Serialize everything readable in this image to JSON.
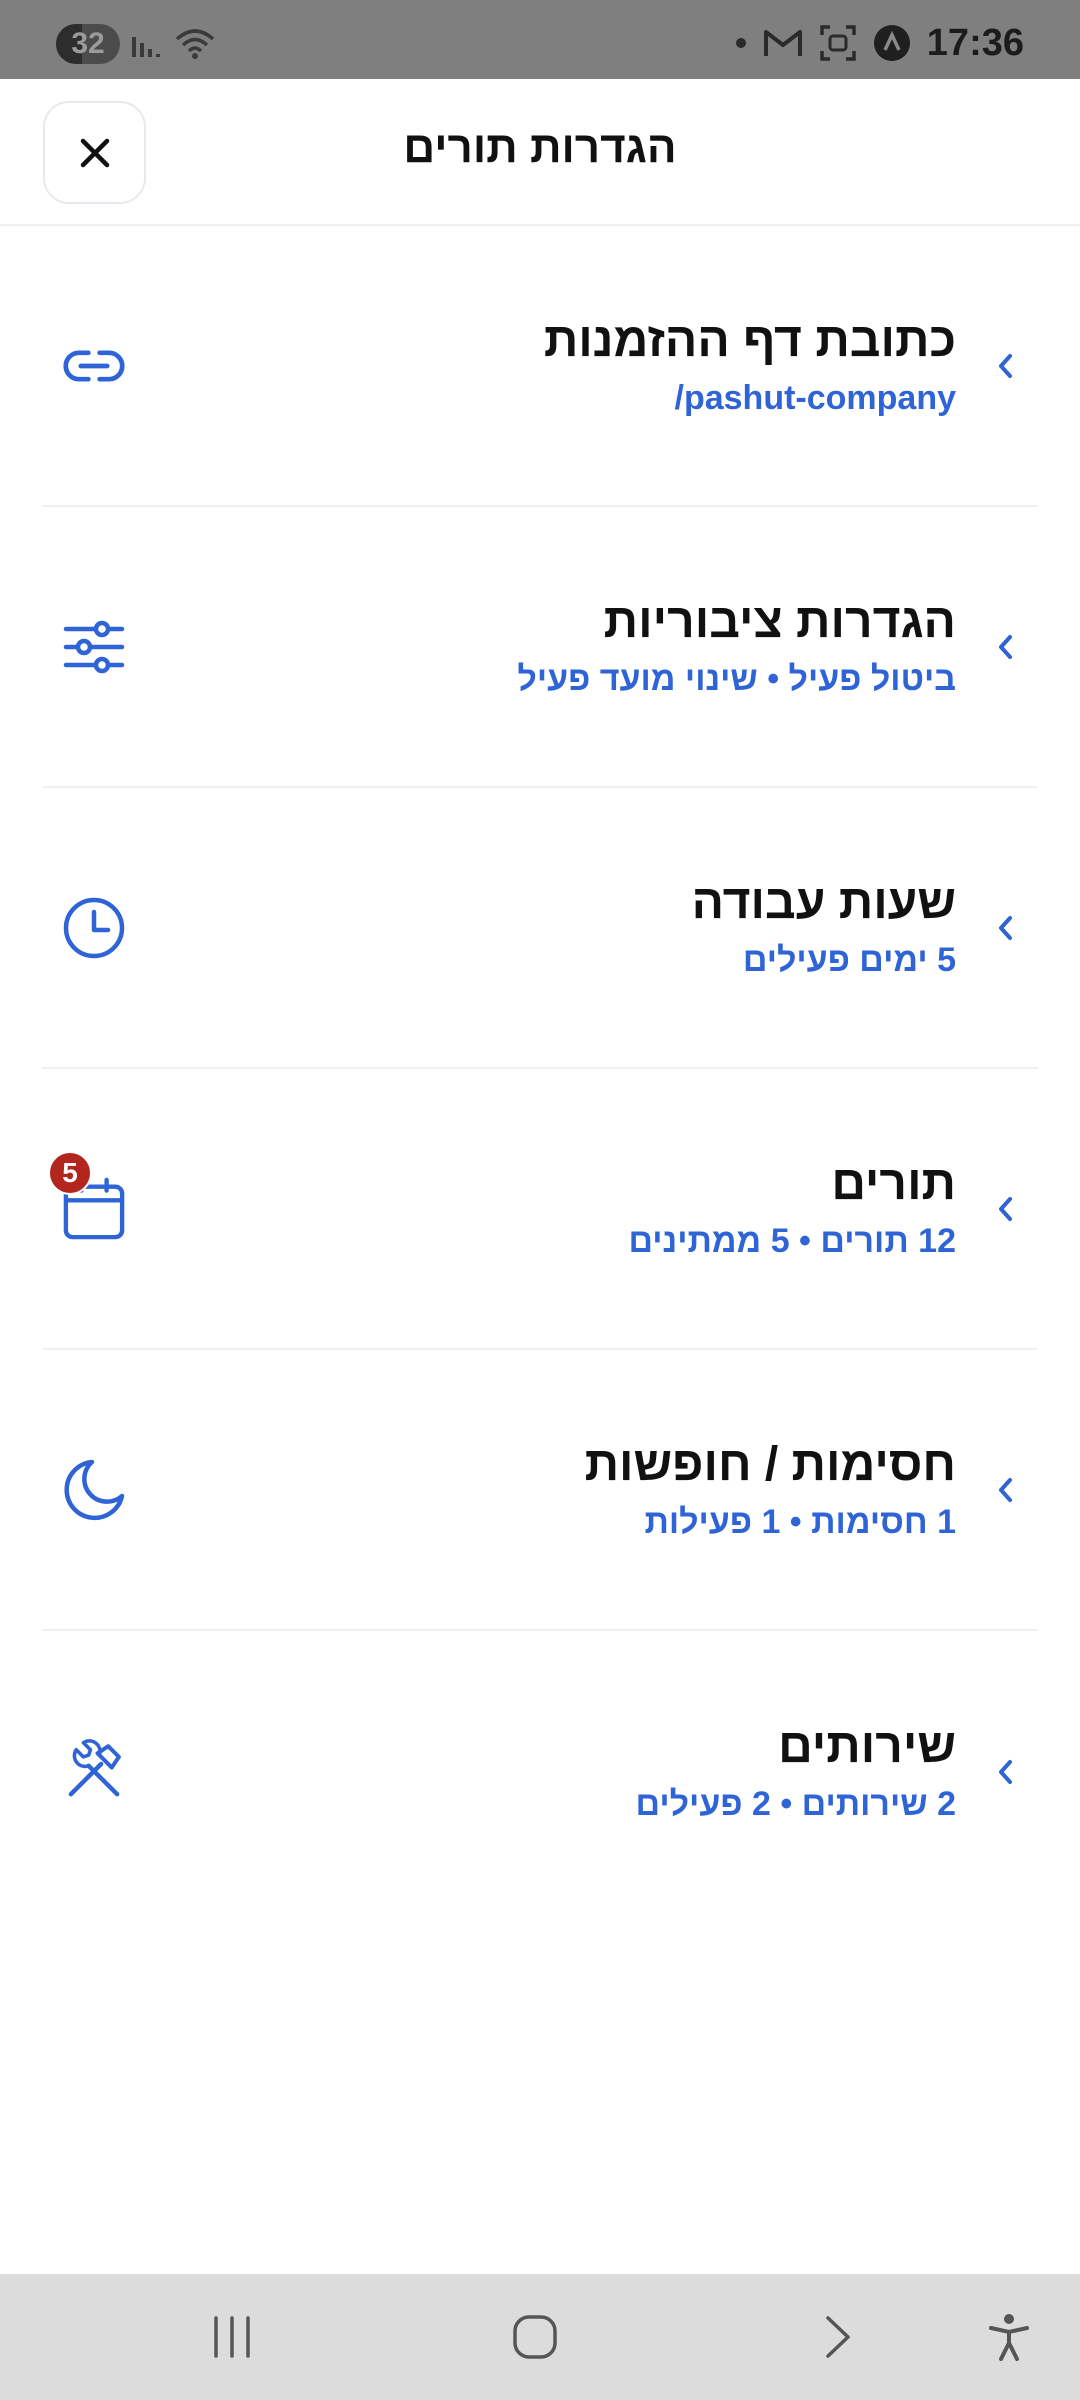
{
  "status_bar": {
    "battery": "32",
    "time": "17:36",
    "icons": [
      "signal-icon",
      "wifi-icon",
      "dot-icon",
      "gmail-icon",
      "screenshot-icon",
      "vpn-icon"
    ]
  },
  "header": {
    "title": "הגדרות תורים",
    "close_icon": "close-icon"
  },
  "settings": [
    {
      "title": "כתובת דף ההזמנות",
      "subtitle": "/pashut-company",
      "icon": "link-icon",
      "ltr": true
    },
    {
      "title": "הגדרות ציבוריות",
      "subtitle": "ביטול פעיל • שינוי מועד פעיל",
      "icon": "sliders-icon"
    },
    {
      "title": "שעות עבודה",
      "subtitle": "5 ימים פעילים",
      "icon": "clock-icon"
    },
    {
      "title": "תורים",
      "subtitle": "12 תורים • 5 ממתינים",
      "icon": "calendar-icon",
      "badge": "5"
    },
    {
      "title": "חסימות / חופשות",
      "subtitle": "1 חסימות • 1 פעילות",
      "icon": "moon-icon"
    },
    {
      "title": "שירותים",
      "subtitle": "2 שירותים • 2 פעילים",
      "icon": "tools-icon"
    }
  ],
  "nav_bar": {
    "buttons": [
      "recents-icon",
      "home-icon",
      "back-icon",
      "accessibility-icon"
    ]
  },
  "colors": {
    "accent": "#2f64d6",
    "badge": "#b3261e",
    "status_bar": "#7f7f7f",
    "nav_bar": "#dcdcdc"
  }
}
